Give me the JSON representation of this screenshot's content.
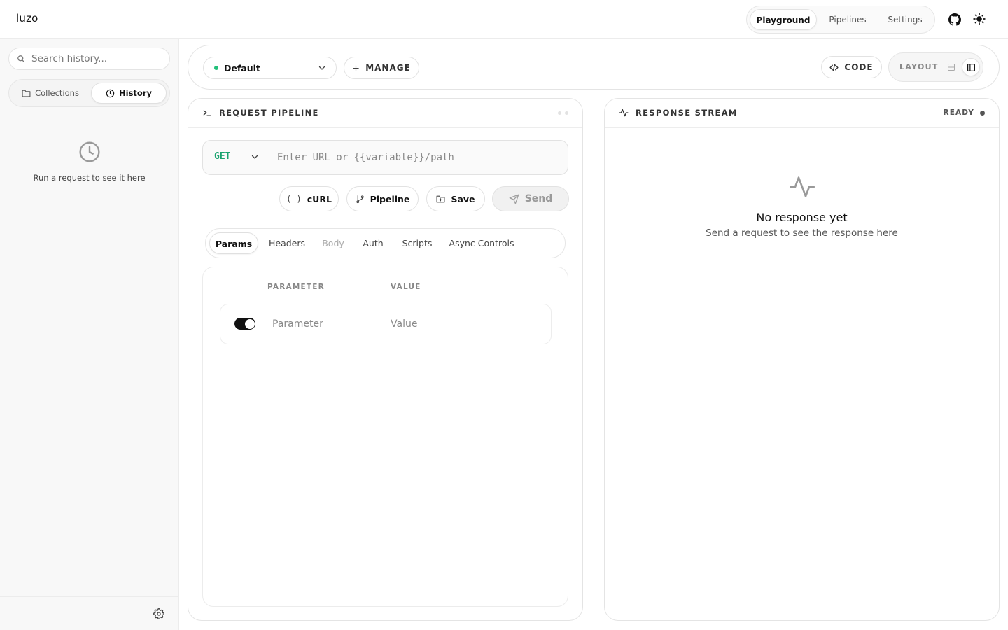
{
  "app": {
    "name": "luzo"
  },
  "nav": {
    "items": [
      "Playground",
      "Pipelines",
      "Settings"
    ],
    "active": "Playground"
  },
  "sidebar": {
    "search_placeholder": "Search history...",
    "tabs": [
      "Collections",
      "History"
    ],
    "active_tab": "History",
    "empty_text": "Run a request to see it here"
  },
  "toolbar": {
    "environment": "Default",
    "manage_label": "MANAGE",
    "code_label": "CODE",
    "layout_label": "LAYOUT"
  },
  "request": {
    "title": "REQUEST PIPELINE",
    "method": "GET",
    "url_placeholder": "Enter URL or {{variable}}/path",
    "actions": {
      "curl": "cURL",
      "pipeline": "Pipeline",
      "save": "Save",
      "send": "Send"
    },
    "tabs": [
      "Params",
      "Headers",
      "Body",
      "Auth",
      "Scripts",
      "Async Controls"
    ],
    "active_tab": "Params",
    "params": {
      "col_param": "PARAMETER",
      "col_value": "VALUE",
      "key_placeholder": "Parameter",
      "value_placeholder": "Value"
    }
  },
  "response": {
    "title": "RESPONSE STREAM",
    "status": "READY",
    "empty_title": "No response yet",
    "empty_subtitle": "Send a request to see the response here"
  },
  "colors": {
    "accent_green": "#1aa36f",
    "env_dot": "#22c07a",
    "text": "#111111"
  }
}
